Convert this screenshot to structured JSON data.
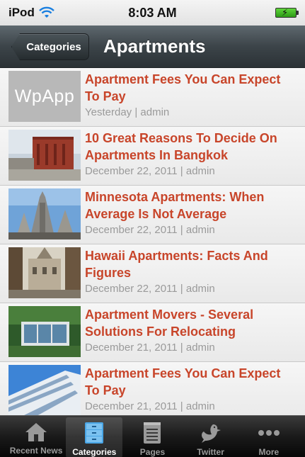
{
  "status_bar": {
    "carrier": "iPod",
    "time": "8:03 AM"
  },
  "nav": {
    "back_label": "Categories",
    "title": "Apartments"
  },
  "items": [
    {
      "title": "Apartment Fees You Can Expect To Pay",
      "meta": "Yesterday | admin",
      "thumb": "WpApp"
    },
    {
      "title": "10 Great Reasons To Decide On Apartments In Bangkok",
      "meta": "December 22, 2011 | admin"
    },
    {
      "title": "Minnesota Apartments: When Average Is Not Average",
      "meta": "December 22, 2011 | admin"
    },
    {
      "title": "Hawaii Apartments: Facts And Figures",
      "meta": "December 22, 2011 | admin"
    },
    {
      "title": "Apartment Movers - Several Solutions For Relocating",
      "meta": "December 21, 2011 | admin"
    },
    {
      "title": "Apartment Fees You Can Expect To Pay",
      "meta": "December 21, 2011 | admin"
    }
  ],
  "tabs": [
    {
      "label": "Recent News",
      "icon": "house-icon"
    },
    {
      "label": "Categories",
      "icon": "cabinet-icon",
      "active": true
    },
    {
      "label": "Pages",
      "icon": "notepad-icon"
    },
    {
      "label": "Twitter",
      "icon": "bird-icon"
    },
    {
      "label": "More",
      "icon": "more-icon"
    }
  ],
  "colors": {
    "title_red": "#c8452a",
    "nav_dark": "#3c4449",
    "active_tab_blue": "#4aa6e6"
  }
}
